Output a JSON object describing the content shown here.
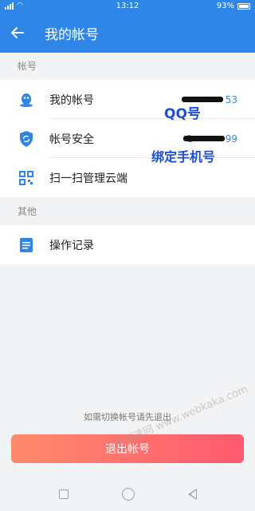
{
  "status_bar": {
    "time": "13:12",
    "battery": "93%",
    "icons": [
      "signal-icon",
      "wifi-icon",
      "battery-icon"
    ]
  },
  "appbar": {
    "title": "我的帐号",
    "back_icon": "arrow-left-icon"
  },
  "sections": {
    "account": {
      "header": "帐号"
    },
    "other": {
      "header": "其他"
    }
  },
  "rows": {
    "my_account": {
      "label": "我的帐号",
      "value_suffix": "53",
      "icon": "qq-penguin-icon"
    },
    "security": {
      "label": "帐号安全",
      "value_prefix": "1",
      "value_suffix": "99",
      "icon": "shield-icon"
    },
    "scan": {
      "label": "扫一扫管理云端",
      "icon": "qr-code-icon"
    },
    "records": {
      "label": "操作记录",
      "icon": "document-icon"
    }
  },
  "annotations": {
    "qq": "QQ号",
    "phone": "绑定手机号"
  },
  "footer": {
    "hint": "如需切换帐号请先退出",
    "logout_button": "退出帐号",
    "watermark": "卡卡测速网 www.webkaka.com"
  },
  "colors": {
    "primary": "#2f86e6",
    "link": "#3a86d8",
    "logout_start": "#ff8a6c",
    "logout_end": "#ff5a6f"
  }
}
